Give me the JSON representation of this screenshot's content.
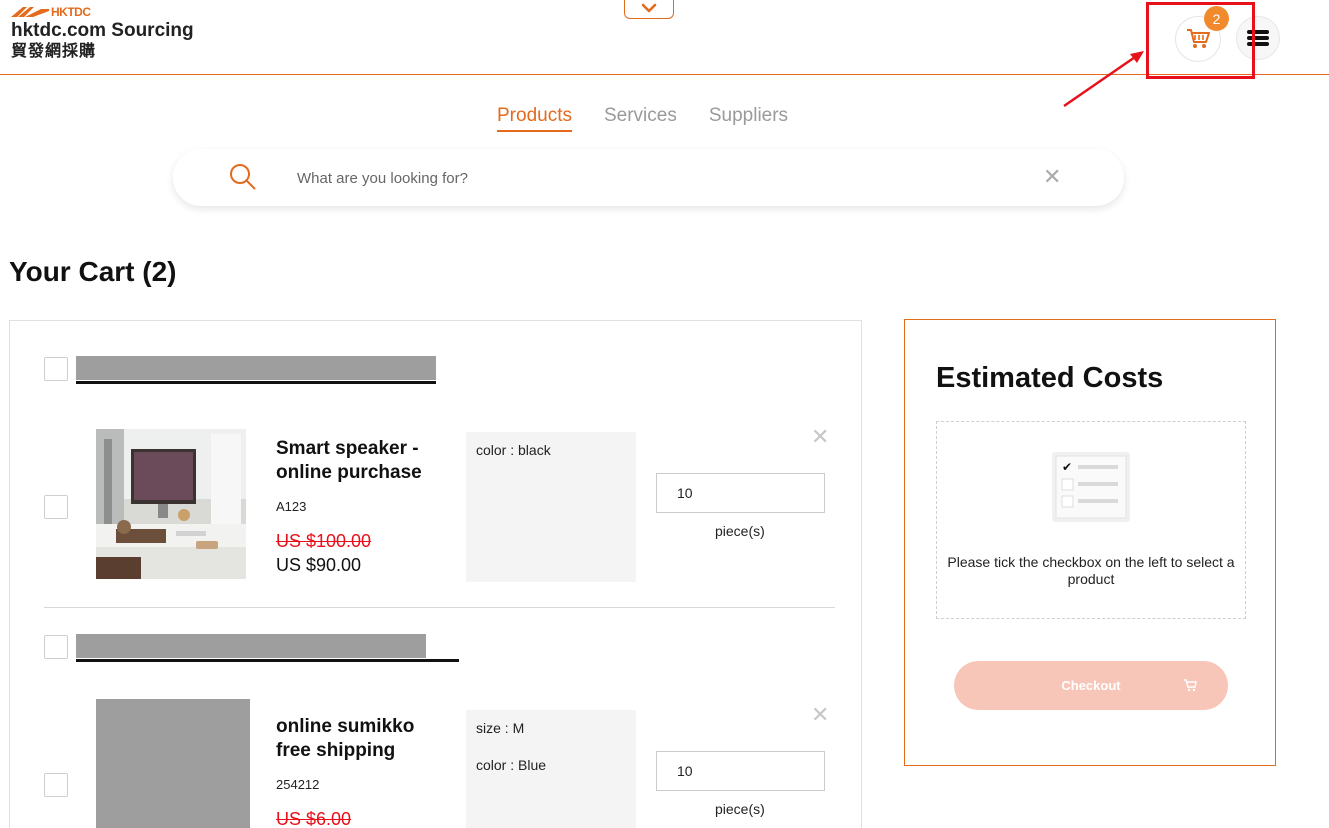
{
  "header": {
    "logo_brand": "HKTDC",
    "logo_title": "hktdc.com Sourcing",
    "logo_chinese": "貿發網採購",
    "cart_count": "2",
    "icons": {
      "collapse": "chevron-down-icon",
      "cart": "cart-icon",
      "menu": "hamburger-menu-icon"
    }
  },
  "tabs": [
    {
      "label": "Products",
      "active": true
    },
    {
      "label": "Services",
      "active": false
    },
    {
      "label": "Suppliers",
      "active": false
    }
  ],
  "search": {
    "placeholder": "What are you looking for?"
  },
  "cart": {
    "title": "Your Cart (2)",
    "groups": [
      {
        "items": [
          {
            "name": "Smart speaker - online purchase",
            "code": "A123",
            "old_price": "US $100.00",
            "price": "US $90.00",
            "attributes": [
              "color : black"
            ],
            "quantity": "10",
            "unit": "piece(s)"
          }
        ]
      },
      {
        "items": [
          {
            "name": "online sumikko free shipping",
            "code": "254212",
            "old_price": "US $6.00",
            "attributes": [
              "size : M",
              "color : Blue"
            ],
            "quantity": "10",
            "unit": "piece(s)"
          }
        ]
      }
    ]
  },
  "estimate": {
    "title": "Estimated Costs",
    "empty_message": "Please tick the checkbox on the left to select a product",
    "checkout_label": "Checkout"
  },
  "colors": {
    "accent": "#e46a1c",
    "badge": "#f08a2c",
    "price_strike": "#e8101a",
    "annotation": "#e8101a",
    "checkout_disabled": "#f8c6b8"
  }
}
